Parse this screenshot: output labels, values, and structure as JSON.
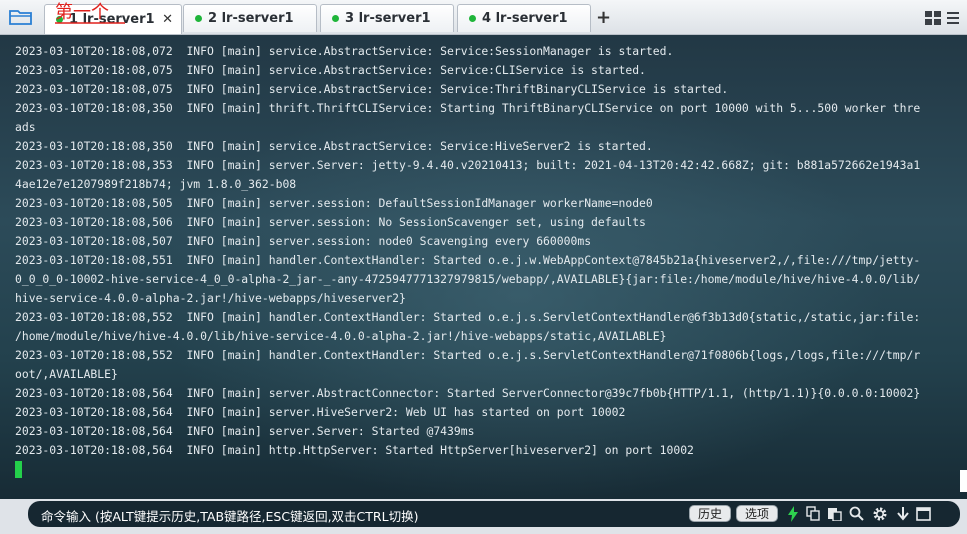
{
  "tabs": [
    {
      "label": "1 lr-server1",
      "active": true
    },
    {
      "label": "2 lr-server1",
      "active": false
    },
    {
      "label": "3 lr-server1",
      "active": false
    },
    {
      "label": "4 lr-server1",
      "active": false
    }
  ],
  "annotation": "第一个",
  "terminal": {
    "lines": [
      "2023-03-10T20:18:08,072  INFO [main] service.AbstractService: Service:SessionManager is started.",
      "2023-03-10T20:18:08,075  INFO [main] service.AbstractService: Service:CLIService is started.",
      "2023-03-10T20:18:08,075  INFO [main] service.AbstractService: Service:ThriftBinaryCLIService is started.",
      "2023-03-10T20:18:08,350  INFO [main] thrift.ThriftCLIService: Starting ThriftBinaryCLIService on port 10000 with 5...500 worker thre",
      "ads",
      "2023-03-10T20:18:08,350  INFO [main] service.AbstractService: Service:HiveServer2 is started.",
      "2023-03-10T20:18:08,353  INFO [main] server.Server: jetty-9.4.40.v20210413; built: 2021-04-13T20:42:42.668Z; git: b881a572662e1943a1",
      "4ae12e7e1207989f218b74; jvm 1.8.0_362-b08",
      "2023-03-10T20:18:08,505  INFO [main] server.session: DefaultSessionIdManager workerName=node0",
      "2023-03-10T20:18:08,506  INFO [main] server.session: No SessionScavenger set, using defaults",
      "2023-03-10T20:18:08,507  INFO [main] server.session: node0 Scavenging every 660000ms",
      "2023-03-10T20:18:08,551  INFO [main] handler.ContextHandler: Started o.e.j.w.WebAppContext@7845b21a{hiveserver2,/,file:///tmp/jetty-",
      "0_0_0_0-10002-hive-service-4_0_0-alpha-2_jar-_-any-4725947771327979815/webapp/,AVAILABLE}{jar:file:/home/module/hive/hive-4.0.0/lib/",
      "hive-service-4.0.0-alpha-2.jar!/hive-webapps/hiveserver2}",
      "2023-03-10T20:18:08,552  INFO [main] handler.ContextHandler: Started o.e.j.s.ServletContextHandler@6f3b13d0{static,/static,jar:file:",
      "/home/module/hive/hive-4.0.0/lib/hive-service-4.0.0-alpha-2.jar!/hive-webapps/static,AVAILABLE}",
      "2023-03-10T20:18:08,552  INFO [main] handler.ContextHandler: Started o.e.j.s.ServletContextHandler@71f0806b{logs,/logs,file:///tmp/r",
      "oot/,AVAILABLE}",
      "2023-03-10T20:18:08,564  INFO [main] server.AbstractConnector: Started ServerConnector@39c7fb0b{HTTP/1.1, (http/1.1)}{0.0.0.0:10002}",
      "2023-03-10T20:18:08,564  INFO [main] server.HiveServer2: Web UI has started on port 10002",
      "2023-03-10T20:18:08,564  INFO [main] server.Server: Started @7439ms",
      "2023-03-10T20:18:08,564  INFO [main] http.HttpServer: Started HttpServer[hiveserver2] on port 10002"
    ]
  },
  "command_bar": {
    "placeholder": "命令输入 (按ALT键提示历史,TAB键路径,ESC键返回,双击CTRL切换)",
    "history_label": "历史",
    "options_label": "选项"
  },
  "icons": {
    "folder": "folder-icon",
    "close": "close-icon",
    "new_tab": "plus-icon",
    "layout": "grid-icon",
    "menu": "menu-icon",
    "lightning": "lightning-icon",
    "copy": "copy-icon",
    "paste": "paste-icon",
    "search": "search-icon",
    "settings": "gear-icon",
    "download": "download-icon",
    "window": "window-icon"
  },
  "colors": {
    "status_dot": "#1fb53a",
    "cursor": "#24d04b",
    "annotation": "#e0201c",
    "terminal_text": "#e4eaee"
  }
}
